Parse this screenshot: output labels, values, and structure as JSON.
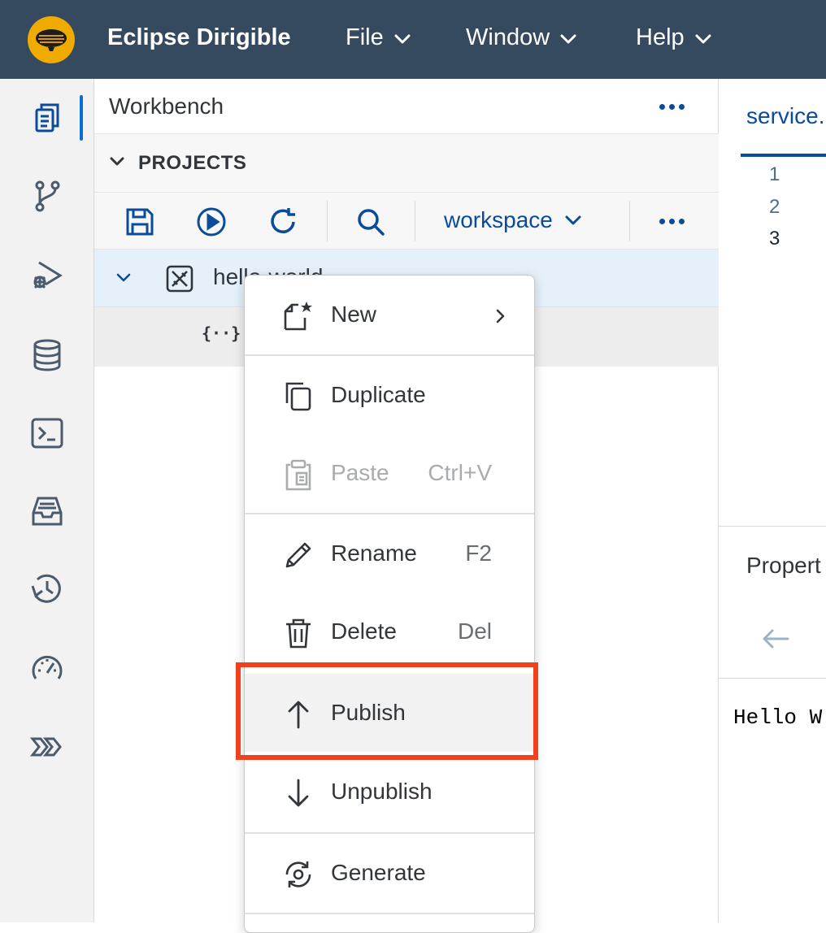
{
  "shell": {
    "app_title": "Eclipse Dirigible",
    "menus": [
      "File",
      "Window",
      "Help"
    ],
    "logo_icon": "dirigible-logo-icon"
  },
  "activity_bar": {
    "items": [
      "projects-icon",
      "git-branch-icon",
      "debug-icon",
      "database-icon",
      "terminal-icon",
      "inbox-icon",
      "history-icon",
      "gauge-icon",
      "chevrons-icon"
    ],
    "active_index": 0
  },
  "workbench": {
    "title": "Workbench",
    "section": "PROJECTS",
    "workspace": "workspace",
    "tree": {
      "project": "hello-world",
      "child_icon": "json-file-icon"
    }
  },
  "editor": {
    "tab": "service.",
    "line_numbers": [
      "1",
      "2",
      "3"
    ]
  },
  "properties": {
    "title": "Propert",
    "console_output": "Hello W"
  },
  "context_menu": {
    "items": [
      {
        "label": "New",
        "shortcut": "",
        "icon": "new-file-icon"
      },
      {
        "label": "Duplicate",
        "shortcut": "",
        "icon": "duplicate-icon"
      },
      {
        "label": "Paste",
        "shortcut": "Ctrl+V",
        "icon": "paste-icon"
      },
      {
        "label": "Rename",
        "shortcut": "F2",
        "icon": "pencil-icon"
      },
      {
        "label": "Delete",
        "shortcut": "Del",
        "icon": "trash-icon"
      },
      {
        "label": "Publish",
        "shortcut": "",
        "icon": "arrow-up-icon"
      },
      {
        "label": "Unpublish",
        "shortcut": "",
        "icon": "arrow-down-icon"
      },
      {
        "label": "Generate",
        "shortcut": "",
        "icon": "generate-icon"
      }
    ],
    "highlighted_item": "Publish"
  },
  "colors": {
    "shell_bg": "#354a5f",
    "accent": "#0a4b9b",
    "highlight_border": "#f0401e",
    "logo": "#f0ab00"
  }
}
